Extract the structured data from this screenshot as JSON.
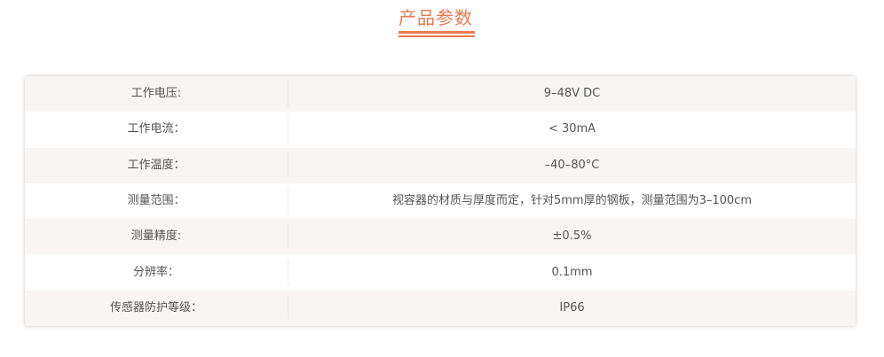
{
  "section": {
    "title": "产品参数"
  },
  "params": [
    {
      "name": "工作电压:",
      "value": "9–48V DC"
    },
    {
      "name": "工作电流：",
      "value": "< 30mA"
    },
    {
      "name": "工作温度：",
      "value": "–40–80°C"
    },
    {
      "name": "测量范围：",
      "value": "视容器的材质与厚度而定，针对5mm厚的钢板，测量范围为3–100cm"
    },
    {
      "name": "测量精度:",
      "value": "±0.5%"
    },
    {
      "name": "分辨率：",
      "value": "0.1mm"
    },
    {
      "name": "传感器防护等级：",
      "value": "IP66"
    }
  ],
  "colors": {
    "accent": "#ec7a52",
    "row_alt": "#f9f5f3",
    "text": "#555555"
  }
}
